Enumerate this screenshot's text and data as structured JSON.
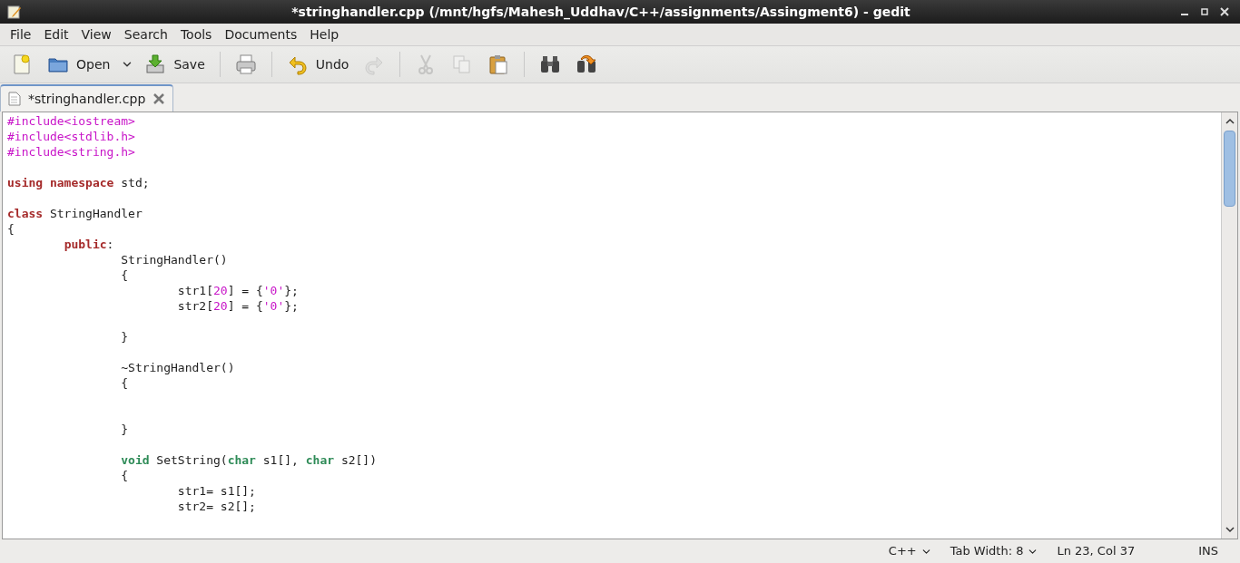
{
  "window": {
    "title": "*stringhandler.cpp (/mnt/hgfs/Mahesh_Uddhav/C++/assignments/Assingment6) - gedit"
  },
  "menu": [
    "File",
    "Edit",
    "View",
    "Search",
    "Tools",
    "Documents",
    "Help"
  ],
  "toolbar": [
    {
      "kind": "new",
      "disabled": false
    },
    {
      "kind": "open",
      "label": "Open",
      "disabled": false
    },
    {
      "kind": "dropdown"
    },
    {
      "kind": "save",
      "label": "Save",
      "disabled": false
    },
    {
      "kind": "separator"
    },
    {
      "kind": "print",
      "disabled": false
    },
    {
      "kind": "separator"
    },
    {
      "kind": "undo",
      "label": "Undo",
      "disabled": false
    },
    {
      "kind": "redo",
      "disabled": true
    },
    {
      "kind": "separator"
    },
    {
      "kind": "cut",
      "disabled": true
    },
    {
      "kind": "copy",
      "disabled": true
    },
    {
      "kind": "paste",
      "disabled": false
    },
    {
      "kind": "separator"
    },
    {
      "kind": "find",
      "disabled": false
    },
    {
      "kind": "replace",
      "disabled": false
    }
  ],
  "tabs": [
    {
      "label": "*stringhandler.cpp",
      "selected": true
    }
  ],
  "editor": {
    "lines": [
      {
        "tokens": [
          {
            "preproc": "#include<iostream>"
          }
        ]
      },
      {
        "tokens": [
          {
            "preproc": "#include<stdlib.h>"
          }
        ]
      },
      {
        "tokens": [
          {
            "preproc": "#include<string.h>"
          }
        ]
      },
      {
        "blank": true
      },
      {
        "tokens": [
          {
            "keyword": "using namespace"
          },
          {
            "plain": " std;"
          }
        ]
      },
      {
        "blank": true
      },
      {
        "tokens": [
          {
            "keyword": "class"
          },
          {
            "plain": " StringHandler"
          }
        ]
      },
      {
        "tokens": [
          {
            "plain": "{"
          }
        ]
      },
      {
        "tokens": [
          {
            "keyword": "\tpublic"
          },
          {
            "plain": ":"
          }
        ]
      },
      {
        "tokens": [
          {
            "plain": "\t\tStringHandler()"
          }
        ]
      },
      {
        "tokens": [
          {
            "plain": "\t\t{"
          }
        ]
      },
      {
        "tokens": [
          {
            "plain": "\t\t\tstr1["
          },
          {
            "number": "20"
          },
          {
            "plain": "] = {"
          },
          {
            "string": "'0'"
          },
          {
            "plain": "};"
          }
        ]
      },
      {
        "tokens": [
          {
            "plain": "\t\t\tstr2["
          },
          {
            "number": "20"
          },
          {
            "plain": "] = {"
          },
          {
            "string": "'0'"
          },
          {
            "plain": "};"
          }
        ]
      },
      {
        "blank": true
      },
      {
        "tokens": [
          {
            "plain": "\t\t}"
          }
        ]
      },
      {
        "blank": true
      },
      {
        "tokens": [
          {
            "plain": "\t\t~StringHandler()"
          }
        ]
      },
      {
        "tokens": [
          {
            "plain": "\t\t{"
          }
        ]
      },
      {
        "blank": true
      },
      {
        "blank": true
      },
      {
        "tokens": [
          {
            "plain": "\t\t}"
          }
        ]
      },
      {
        "blank": true
      },
      {
        "tokens": [
          {
            "type": "\t\tvoid"
          },
          {
            "plain": " SetString("
          },
          {
            "type": "char"
          },
          {
            "plain": " s1[], "
          },
          {
            "type": "char"
          },
          {
            "plain": " s2[])"
          }
        ]
      },
      {
        "tokens": [
          {
            "plain": "\t\t{"
          }
        ]
      },
      {
        "tokens": [
          {
            "plain": "\t\t\tstr1= s1[];"
          }
        ]
      },
      {
        "tokens": [
          {
            "plain": "\t\t\tstr2= s2[];"
          }
        ]
      }
    ]
  },
  "status_bar": {
    "language": "C++",
    "tab_width": "Tab Width: 8",
    "position": "Ln 23, Col 37",
    "mode": "INS"
  }
}
